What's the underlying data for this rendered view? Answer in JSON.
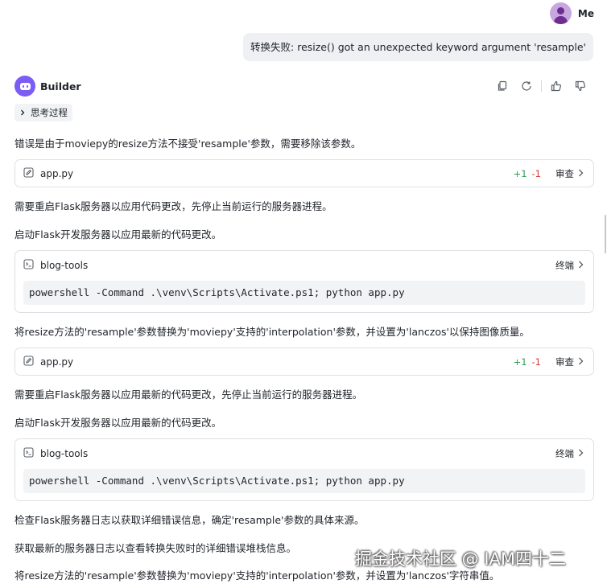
{
  "user": {
    "name": "Me"
  },
  "user_message": "转换失败: resize() got an unexpected keyword argument 'resample'",
  "bot": {
    "name": "Builder"
  },
  "thinking_label": "思考过程",
  "paragraphs": [
    "错误是由于moviepy的resize方法不接受'resample'参数，需要移除该参数。",
    "需要重启Flask服务器以应用代码更改，先停止当前运行的服务器进程。",
    "启动Flask开发服务器以应用最新的代码更改。",
    "将resize方法的'resample'参数替换为'moviepy'支持的'interpolation'参数，并设置为'lanczos'以保持图像质量。",
    "需要重启Flask服务器以应用最新的代码更改，先停止当前运行的服务器进程。",
    "启动Flask开发服务器以应用最新的代码更改。",
    "检查Flask服务器日志以获取详细错误信息，确定'resample'参数的具体来源。",
    "获取最新的服务器日志以查看转换失败时的详细错误堆栈信息。",
    "将resize方法的'resample'参数替换为'moviepy'支持的'interpolation'参数，并设置为'lanczos'字符串值。"
  ],
  "file_cards": [
    {
      "filename": "app.py",
      "added": "+1",
      "removed": "-1",
      "action": "审查"
    },
    {
      "filename": "app.py",
      "added": "+1",
      "removed": "-1",
      "action": "审查"
    }
  ],
  "terminal_cards": [
    {
      "name": "blog-tools",
      "action": "终端",
      "command": "powershell -Command .\\venv\\Scripts\\Activate.ps1; python app.py"
    },
    {
      "name": "blog-tools",
      "action": "终端",
      "command": "powershell -Command .\\venv\\Scripts\\Activate.ps1; python app.py"
    }
  ],
  "watermark": "掘金技术社区 @ IAM四十二",
  "icons": {
    "copy": "copy-icon",
    "regenerate": "refresh-icon",
    "like": "thumbs-up-icon",
    "dislike": "thumbs-down-icon",
    "file": "file-edit-icon",
    "terminal": "terminal-icon",
    "chevron": "chevron-right-icon"
  },
  "colors": {
    "bot_avatar": "#7b5cf5",
    "user_avatar": "#c8a6e0",
    "diff_added": "#2e9d57",
    "diff_removed": "#d93a3a"
  }
}
